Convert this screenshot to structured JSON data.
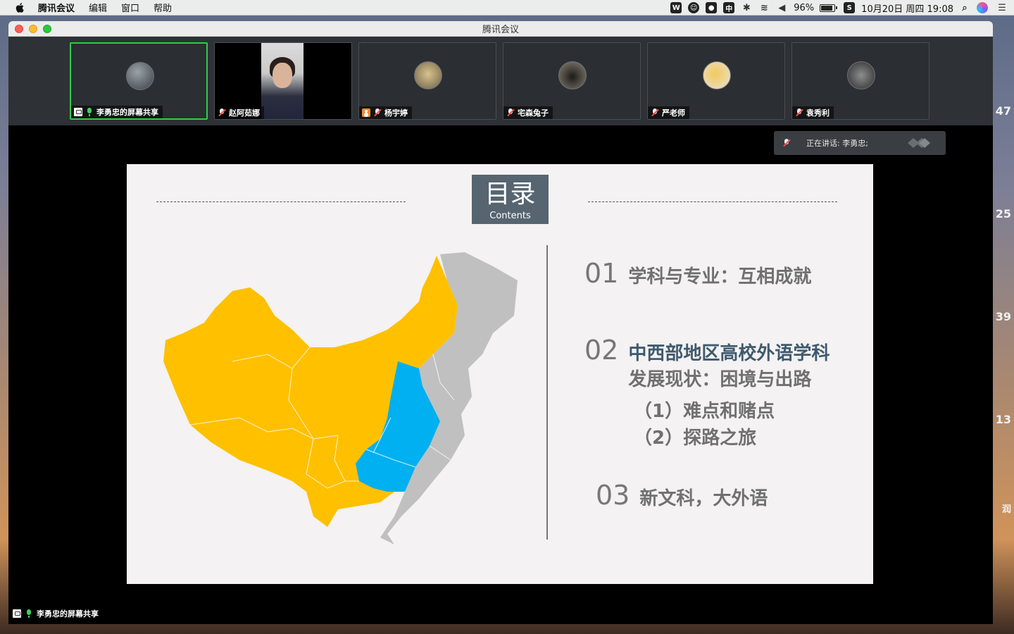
{
  "menubar": {
    "app_name": "腾讯会议",
    "menus": [
      "编辑",
      "窗口",
      "帮助"
    ],
    "status": {
      "battery_text": "96%",
      "battery_level": 0.96,
      "ime": "中",
      "datetime": "10月20日 周四 19:08"
    }
  },
  "desktop": {
    "side_numbers": [
      "47",
      "25",
      "39",
      "13",
      "润"
    ]
  },
  "window": {
    "title": "腾讯会议"
  },
  "participants": [
    {
      "name": "李勇忠的屏幕共享",
      "mic": "on",
      "sharing": true,
      "active": true
    },
    {
      "name": "赵阿茹娜",
      "mic": "off",
      "video": true
    },
    {
      "name": "杨宇婷",
      "mic": "off",
      "host_icon": true
    },
    {
      "name": "宅森兔子",
      "mic": "off"
    },
    {
      "name": "严老师",
      "mic": "off"
    },
    {
      "name": "袁秀利",
      "mic": "off"
    }
  ],
  "speaking": {
    "label": "正在讲话: 李勇忠;"
  },
  "slide": {
    "header_big": "目录",
    "header_small": "Contents",
    "items": [
      {
        "num": "01",
        "text": "学科与专业：互相成就"
      },
      {
        "num": "02",
        "text_line1": "中西部地区高校外语学科",
        "text_line2": "发展现状：困境与出路"
      },
      {
        "num": "03",
        "text": "新文科，大外语"
      }
    ],
    "sub_items": [
      "（1）难点和赌点",
      "（2）探路之旅"
    ],
    "colors": {
      "west": "#ffc000",
      "central": "#00b0f0",
      "east": "#c0c0c0"
    }
  },
  "bottom_bar": {
    "share_label": "李勇忠的屏幕共享"
  }
}
